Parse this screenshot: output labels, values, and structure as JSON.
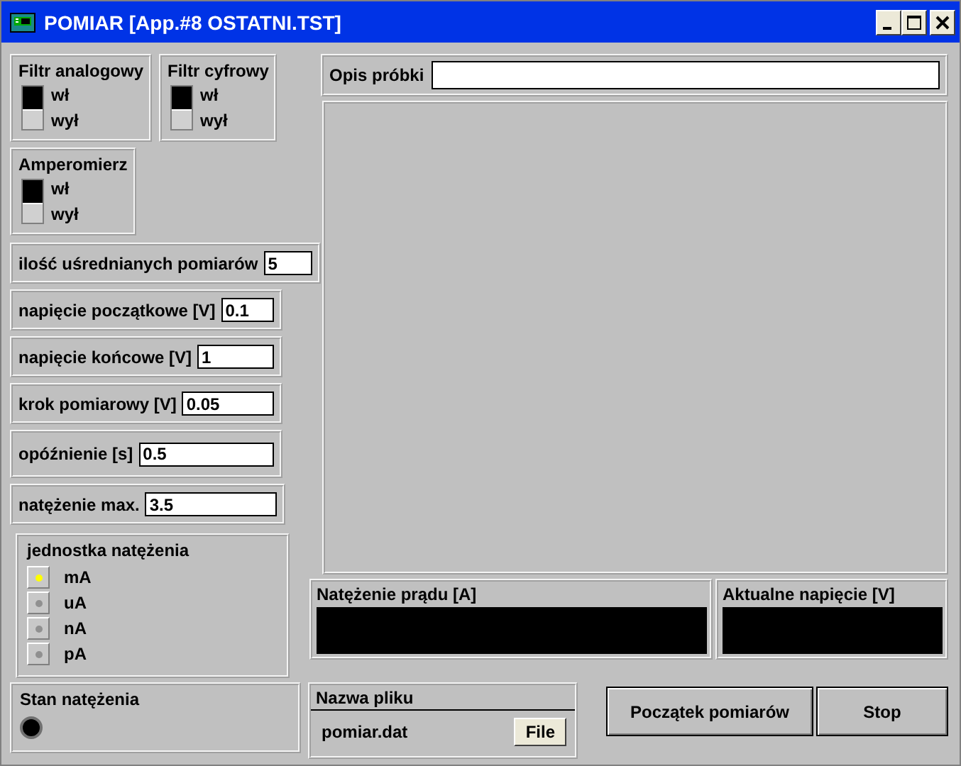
{
  "window": {
    "title": "POMIAR [App.#8 OSTATNI.TST]"
  },
  "switch_rows": [
    [
      {
        "label": "Filtr analogowy",
        "on_label": "wł",
        "off_label": "wył",
        "on": false
      },
      {
        "label": "Filtr cyfrowy",
        "on_label": "wł",
        "off_label": "wył",
        "on": false
      }
    ],
    [
      {
        "label": "Amperomierz",
        "on_label": "wł",
        "off_label": "wył",
        "on": false
      }
    ]
  ],
  "params": [
    {
      "label": "ilość uśrednianych pomiarów",
      "value": "5"
    },
    {
      "label": "napięcie początkowe [V]",
      "value": "0.1"
    },
    {
      "label": "napięcie końcowe [V]",
      "value": "1"
    },
    {
      "label": "krok pomiarowy [V]",
      "value": "0.05"
    },
    {
      "label": "opóźnienie [s]",
      "value": "0.5"
    },
    {
      "label": "natężenie max.",
      "value": "3.5"
    }
  ],
  "unit": {
    "title": "jednostka natężenia",
    "options": [
      {
        "label": "mA",
        "selected": true
      },
      {
        "label": "uA",
        "selected": false
      },
      {
        "label": "nA",
        "selected": false
      },
      {
        "label": "pA",
        "selected": false
      }
    ]
  },
  "status": {
    "title": "Stan natężenia",
    "on": false
  },
  "sample": {
    "label": "Opis próbki"
  },
  "displays": [
    {
      "label": "Natężenie prądu [A]"
    },
    {
      "label": "Aktualne napięcie [V]"
    }
  ],
  "file": {
    "title": "Nazwa pliku",
    "name": "pomiar.dat",
    "button": "File"
  },
  "buttons": [
    "Początek pomiarów",
    "Stop"
  ]
}
